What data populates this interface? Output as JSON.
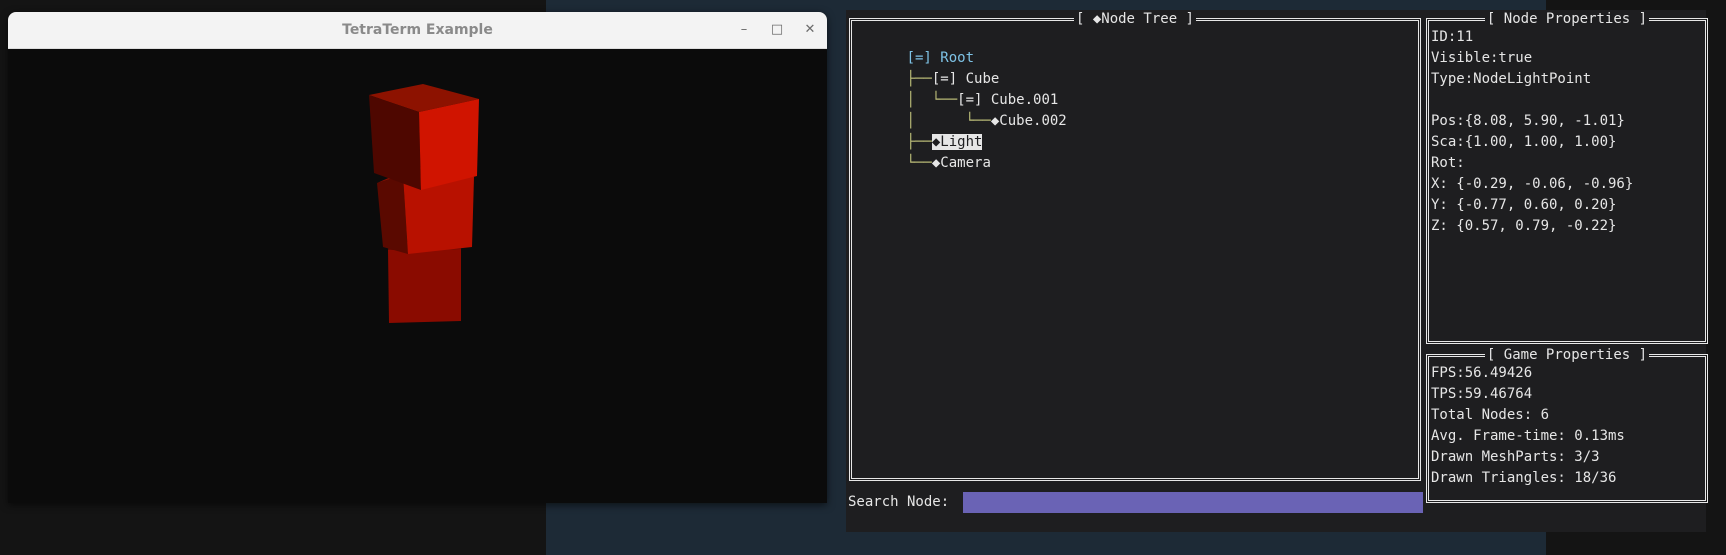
{
  "window": {
    "title": "TetraTerm Example",
    "minimize_glyph": "–",
    "maximize_glyph": "□",
    "close_glyph": "✕"
  },
  "node_tree": {
    "title": "[ ◆Node Tree ]",
    "items": [
      {
        "prefix": "",
        "label": "[=] Root"
      },
      {
        "prefix": "├──",
        "label": "[=] Cube"
      },
      {
        "prefix": "│  └──",
        "label": "[=] Cube.001"
      },
      {
        "prefix": "│      └──",
        "label": "◆Cube.002"
      },
      {
        "prefix": "├──",
        "label": "◆Light"
      },
      {
        "prefix": "└──",
        "label": "◆Camera"
      }
    ]
  },
  "node_properties": {
    "title": "[ Node Properties ]",
    "lines": [
      "ID:11",
      "Visible:true",
      "Type:NodeLightPoint",
      "",
      "Pos:{8.08, 5.90, -1.01}",
      "Sca:{1.00, 1.00, 1.00}",
      "Rot:",
      "X: {-0.29, -0.06, -0.96}",
      "Y: {-0.77, 0.60, 0.20}",
      "Z: {0.57, 0.79, -0.22}"
    ]
  },
  "game_properties": {
    "title": "[ Game Properties ]",
    "lines": [
      "FPS:56.49426",
      "TPS:59.46764",
      "Total Nodes: 6",
      "Avg. Frame-time: 0.13ms",
      "Drawn MeshParts: 3/3",
      "Drawn Triangles: 18/36"
    ]
  },
  "search": {
    "label": "Search Node:",
    "value": ""
  },
  "colors": {
    "accent": "#6a63b5",
    "root_text": "#7ec3e6",
    "tree_lines": "#bfc07a",
    "cube_red": "#d01400"
  }
}
